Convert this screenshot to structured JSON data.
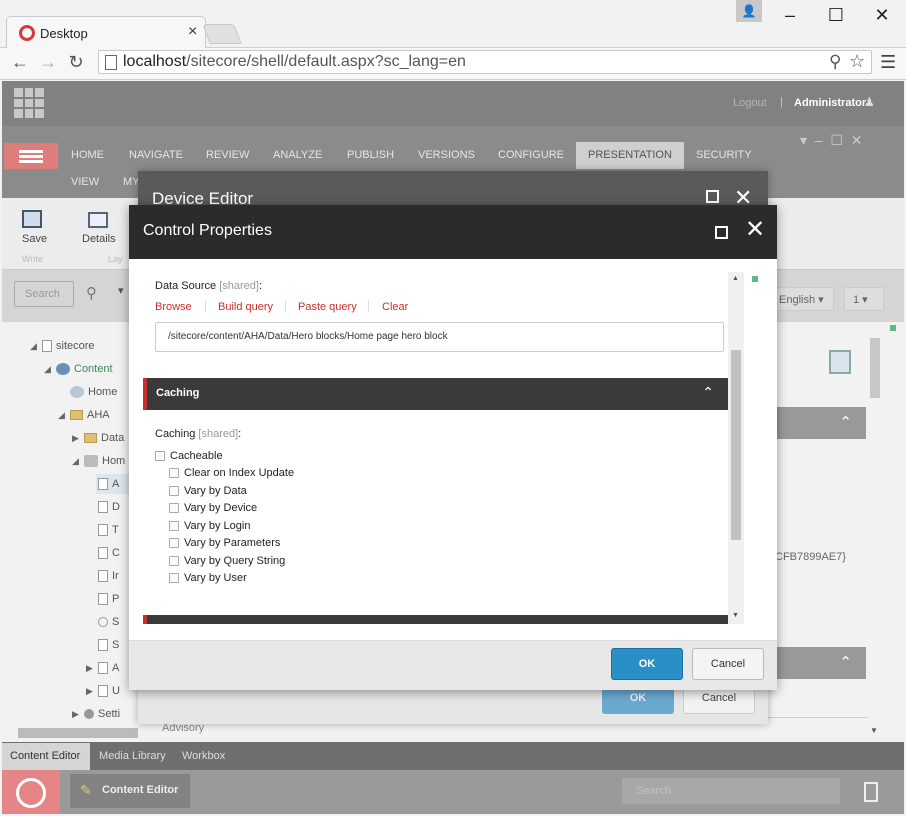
{
  "browser": {
    "tab_title": "Desktop",
    "tab_close": "×",
    "url_host": "localhost",
    "url_path": "/sitecore/shell/default.aspx?sc_lang=en",
    "window_controls": [
      "–",
      "☐",
      "✕"
    ]
  },
  "header": {
    "logout": "Logout",
    "separator": "|",
    "user": "Administrator"
  },
  "ribbon": {
    "tabs": [
      "HOME",
      "NAVIGATE",
      "REVIEW",
      "ANALYZE",
      "PUBLISH",
      "VERSIONS",
      "CONFIGURE",
      "PRESENTATION",
      "SECURITY"
    ],
    "active_tab": "PRESENTATION",
    "tabs_row2": [
      "VIEW",
      "MY"
    ],
    "buttons": [
      {
        "label": "Save",
        "group": "Write"
      },
      {
        "label": "Details",
        "group": "Lay"
      }
    ]
  },
  "search": {
    "placeholder": "Search",
    "language": "English",
    "version": "1"
  },
  "tree": {
    "items": [
      {
        "label": "sitecore",
        "arrow": "◢"
      },
      {
        "label": "Content",
        "arrow": "◢"
      },
      {
        "label": "Home",
        "arrow": ""
      },
      {
        "label": "AHA",
        "arrow": "◢"
      },
      {
        "label": "Data",
        "arrow": "▶"
      },
      {
        "label": "Hom",
        "arrow": "◢"
      },
      {
        "label": "A",
        "arrow": ""
      },
      {
        "label": "D",
        "arrow": ""
      },
      {
        "label": "T",
        "arrow": ""
      },
      {
        "label": "C",
        "arrow": ""
      },
      {
        "label": "Ir",
        "arrow": ""
      },
      {
        "label": "P",
        "arrow": ""
      },
      {
        "label": "S",
        "arrow": ""
      },
      {
        "label": "S",
        "arrow": ""
      },
      {
        "label": "A",
        "arrow": "▶"
      },
      {
        "label": "U",
        "arrow": "▶"
      },
      {
        "label": "Setti",
        "arrow": "▶"
      }
    ]
  },
  "right_panel": {
    "id_fragment": "CFB7899AE7}",
    "advisory": "Advisory"
  },
  "device_editor": {
    "title": "Device Editor",
    "ok": "OK",
    "cancel": "Cancel"
  },
  "control_properties": {
    "title": "Control Properties",
    "data_source": {
      "label": "Data Source",
      "shared": "[shared]",
      "colon": ":",
      "links": [
        "Browse",
        "Build query",
        "Paste query",
        "Clear"
      ],
      "value": "/sitecore/content/AHA/Data/Hero blocks/Home page hero block"
    },
    "caching_section": {
      "title": "Caching",
      "chevron": "⌃"
    },
    "caching": {
      "label": "Caching",
      "shared": "[shared]",
      "colon": ":",
      "cacheable": "Cacheable",
      "options": [
        "Clear on Index Update",
        "Vary by Data",
        "Vary by Device",
        "Vary by Login",
        "Vary by Parameters",
        "Vary by Query String",
        "Vary by User"
      ]
    },
    "ok": "OK",
    "cancel": "Cancel"
  },
  "bottom_tabs": [
    "Content Editor",
    "Media Library",
    "Workbox"
  ],
  "taskbar": {
    "app_button": "Content Editor",
    "search_placeholder": "Search"
  }
}
